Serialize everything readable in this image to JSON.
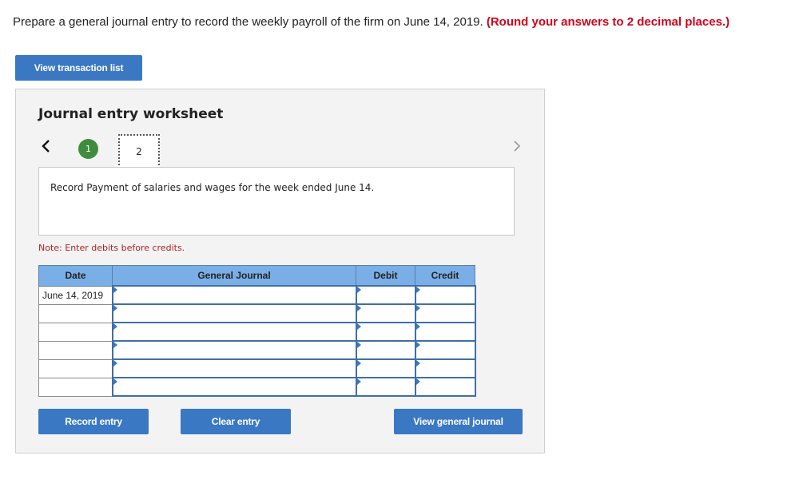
{
  "question": {
    "text": "Prepare a general journal entry to record the weekly payroll of the firm on June 14, 2019.",
    "hint": "(Round your answers to 2 decimal places.)"
  },
  "buttons": {
    "view_transactions": "View transaction list",
    "record_entry": "Record entry",
    "clear_entry": "Clear entry",
    "view_general_journal": "View general journal"
  },
  "worksheet": {
    "title": "Journal entry worksheet",
    "steps": [
      "1",
      "2"
    ],
    "description": "Record Payment of salaries and wages for the week ended June 14.",
    "note": "Note: Enter debits before credits."
  },
  "table": {
    "headers": [
      "Date",
      "General Journal",
      "Debit",
      "Credit"
    ],
    "rows": [
      {
        "date": "June 14, 2019",
        "account": "",
        "debit": "",
        "credit": ""
      },
      {
        "date": "",
        "account": "",
        "debit": "",
        "credit": ""
      },
      {
        "date": "",
        "account": "",
        "debit": "",
        "credit": ""
      },
      {
        "date": "",
        "account": "",
        "debit": "",
        "credit": ""
      },
      {
        "date": "",
        "account": "",
        "debit": "",
        "credit": ""
      },
      {
        "date": "",
        "account": "",
        "debit": "",
        "credit": ""
      }
    ]
  },
  "colors": {
    "accent": "#3a78c3",
    "header": "#7aaee6",
    "hint": "#d0021b",
    "step_done": "#3e8d3e",
    "note": "#b22222"
  }
}
